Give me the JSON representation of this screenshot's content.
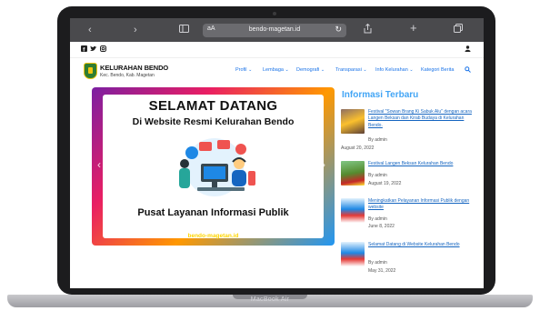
{
  "device": {
    "label": "MacBook Air"
  },
  "browser": {
    "url": "bendo-magetan.id",
    "aa_label": "aA",
    "icons": [
      "sidebar-icon",
      "back-icon",
      "forward-icon",
      "reload-icon",
      "share-icon",
      "new-tab-icon",
      "tabs-icon"
    ]
  },
  "site": {
    "logo_title": "KELURAHAN BENDO",
    "logo_sub": "Kec. Bendo, Kab. Magetan",
    "nav": [
      {
        "label": "Profil",
        "dropdown": true
      },
      {
        "label": "Lembaga",
        "dropdown": true
      },
      {
        "label": "Demografi",
        "dropdown": true
      },
      {
        "label": "Transparasi",
        "dropdown": true
      },
      {
        "label": "Info Kelurahan",
        "dropdown": true
      },
      {
        "label": "Kategori Berita",
        "dropdown": false
      }
    ],
    "social_icons": [
      "facebook-icon",
      "twitter-icon",
      "instagram-icon"
    ]
  },
  "slider": {
    "title": "SELAMAT DATANG",
    "subtitle": "Di Website Resmi Kelurahan Bendo",
    "footer": "Pusat Layanan Informasi Publik",
    "url_text": "bendo-magetan.id"
  },
  "sidebar": {
    "title": "Informasi Terbaru",
    "posts": [
      {
        "title": "Festival \"Sowan Brang Ki Sabuk Alu\" dengan acara Langen Beksan dan Kirab Budaya di Kelurahan Bendo.",
        "author": "By admin",
        "date": "August 20, 2022"
      },
      {
        "title": "Festival Langen Beksan Kelurahan Bendo",
        "author": "By admin",
        "date": "August 19, 2022"
      },
      {
        "title": "Meningkatkan Pelayanan Informasi Publik dengan website",
        "author": "By admin",
        "date": "June 8, 2022"
      },
      {
        "title": "Selamat Datang di Website Kelurahan Bendo",
        "author": "By admin",
        "date": "May 31, 2022"
      }
    ]
  }
}
